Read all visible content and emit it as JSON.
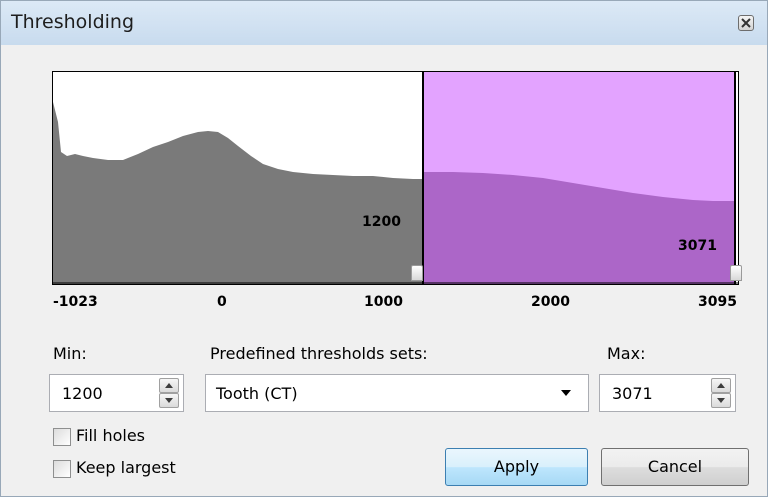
{
  "window": {
    "title": "Thresholding"
  },
  "histogram": {
    "range_min": -1023,
    "range_max": 3095,
    "threshold_min": 1200,
    "threshold_max": 3071,
    "axis_ticks": [
      "-1023",
      "0",
      "1000",
      "2000",
      "3095"
    ],
    "min_label": "1200",
    "max_label": "3071",
    "colors": {
      "histogram": "#7a7a7a",
      "selection": "#e3a3ff",
      "selected_histogram": "#ac66c8"
    }
  },
  "form": {
    "min_label": "Min:",
    "min_value": "1200",
    "preset_label": "Predefined thresholds sets:",
    "preset_value": "Tooth (CT)",
    "max_label": "Max:",
    "max_value": "3071",
    "fill_holes_label": "Fill holes",
    "fill_holes_checked": false,
    "keep_largest_label": "Keep largest",
    "keep_largest_checked": false,
    "apply_label": "Apply",
    "cancel_label": "Cancel"
  }
}
